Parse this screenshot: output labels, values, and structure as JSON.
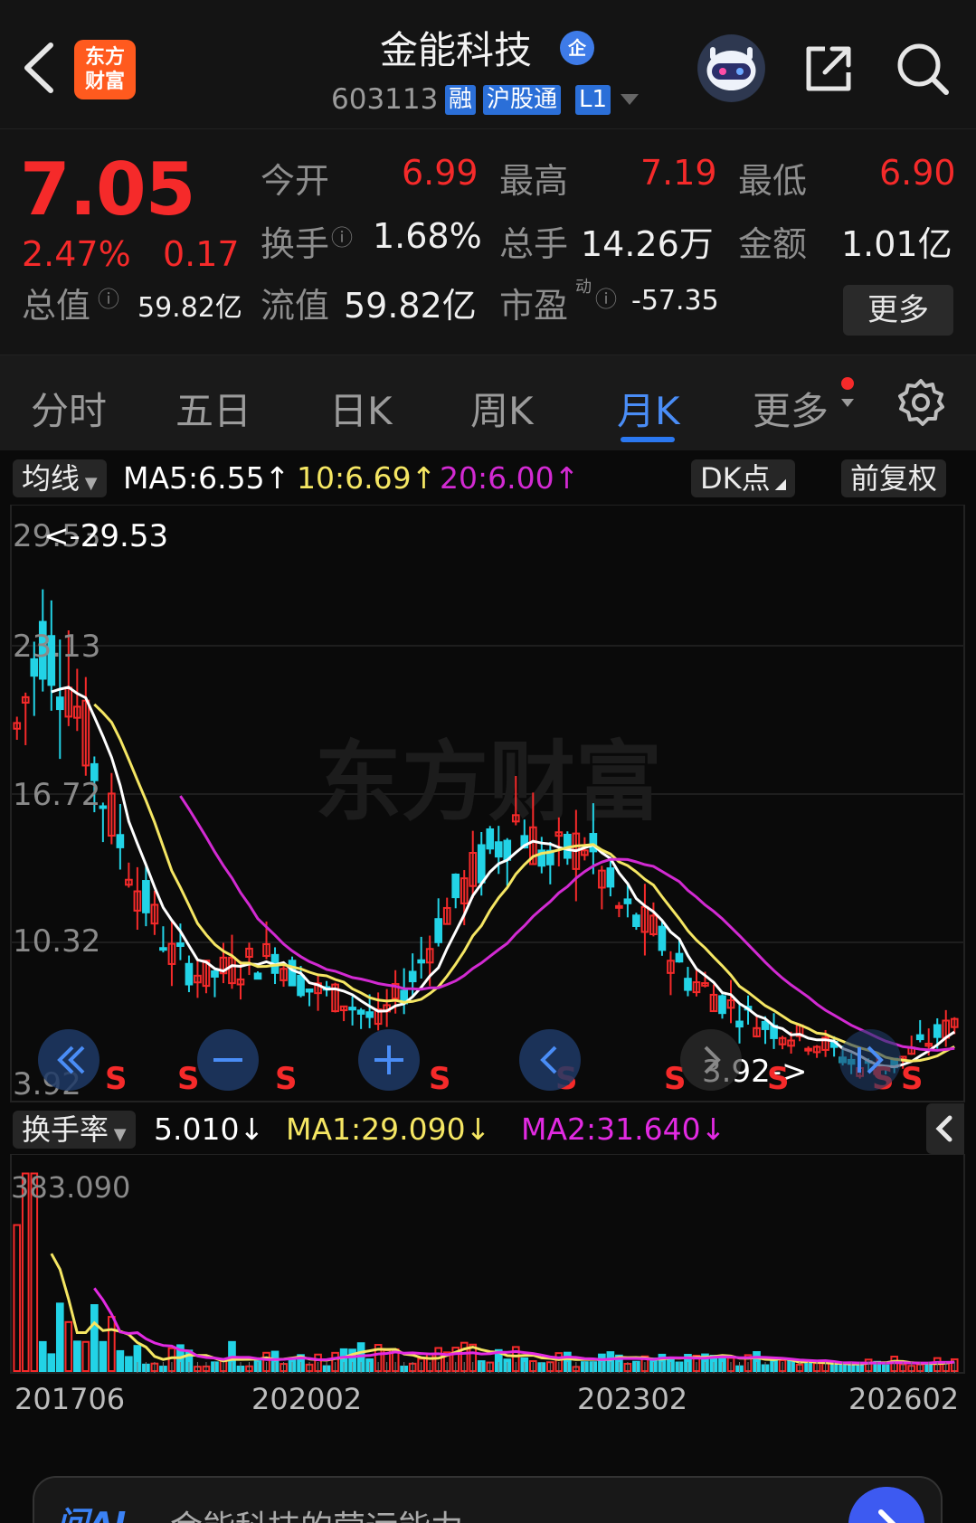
{
  "header": {
    "logo_line1": "东方",
    "logo_line2": "财富",
    "title": "金能科技",
    "qi_badge": "企",
    "code": "603113",
    "tags": [
      "融",
      "沪股通",
      "L1"
    ]
  },
  "quote": {
    "price": "7.05",
    "pct": "2.47%",
    "change": "0.17",
    "open_label": "今开",
    "open": "6.99",
    "high_label": "最高",
    "high": "7.19",
    "low_label": "最低",
    "low": "6.90",
    "turnover_label": "换手",
    "turnover": "1.68%",
    "volume_label": "总手",
    "volume": "14.26万",
    "amount_label": "金额",
    "amount": "1.01亿",
    "mktcap_label": "总值",
    "mktcap": "59.82亿",
    "float_label": "流值",
    "float": "59.82亿",
    "pe_label": "市盈",
    "pe_sup": "动",
    "pe": "-57.35",
    "more": "更多"
  },
  "tabs": [
    "分时",
    "五日",
    "日K",
    "周K",
    "月K",
    "更多"
  ],
  "active_tab": "月K",
  "ma_row": {
    "selector": "均线",
    "ma5": "MA5:6.55↑",
    "ma10": "10:6.69↑",
    "ma20": "20:6.00↑",
    "dk": "DK点",
    "adjust": "前复权"
  },
  "kline": {
    "y_ticks": [
      "29.53",
      "23.13",
      "16.72",
      "10.32",
      "3.92"
    ],
    "max_marker": "<-29.53",
    "min_marker": "3.92->",
    "signal": "S",
    "watermark": "东方财富"
  },
  "volume": {
    "selector": "换手率",
    "value": "5.010↓",
    "ma1": "MA1:29.090↓",
    "ma2": "MA2:31.640↓",
    "y_max": "383.090"
  },
  "x_labels": [
    "201706",
    "202002",
    "202302",
    "202602"
  ],
  "ask": {
    "logo": "问AI",
    "placeholder": "金能科技的营运能力"
  },
  "colors": {
    "up": "#f52a2a",
    "down": "#22d3e6",
    "ma5": "#ffffff",
    "ma10": "#f5e663",
    "ma20": "#d22ad2",
    "accent": "#4a8df6"
  }
}
